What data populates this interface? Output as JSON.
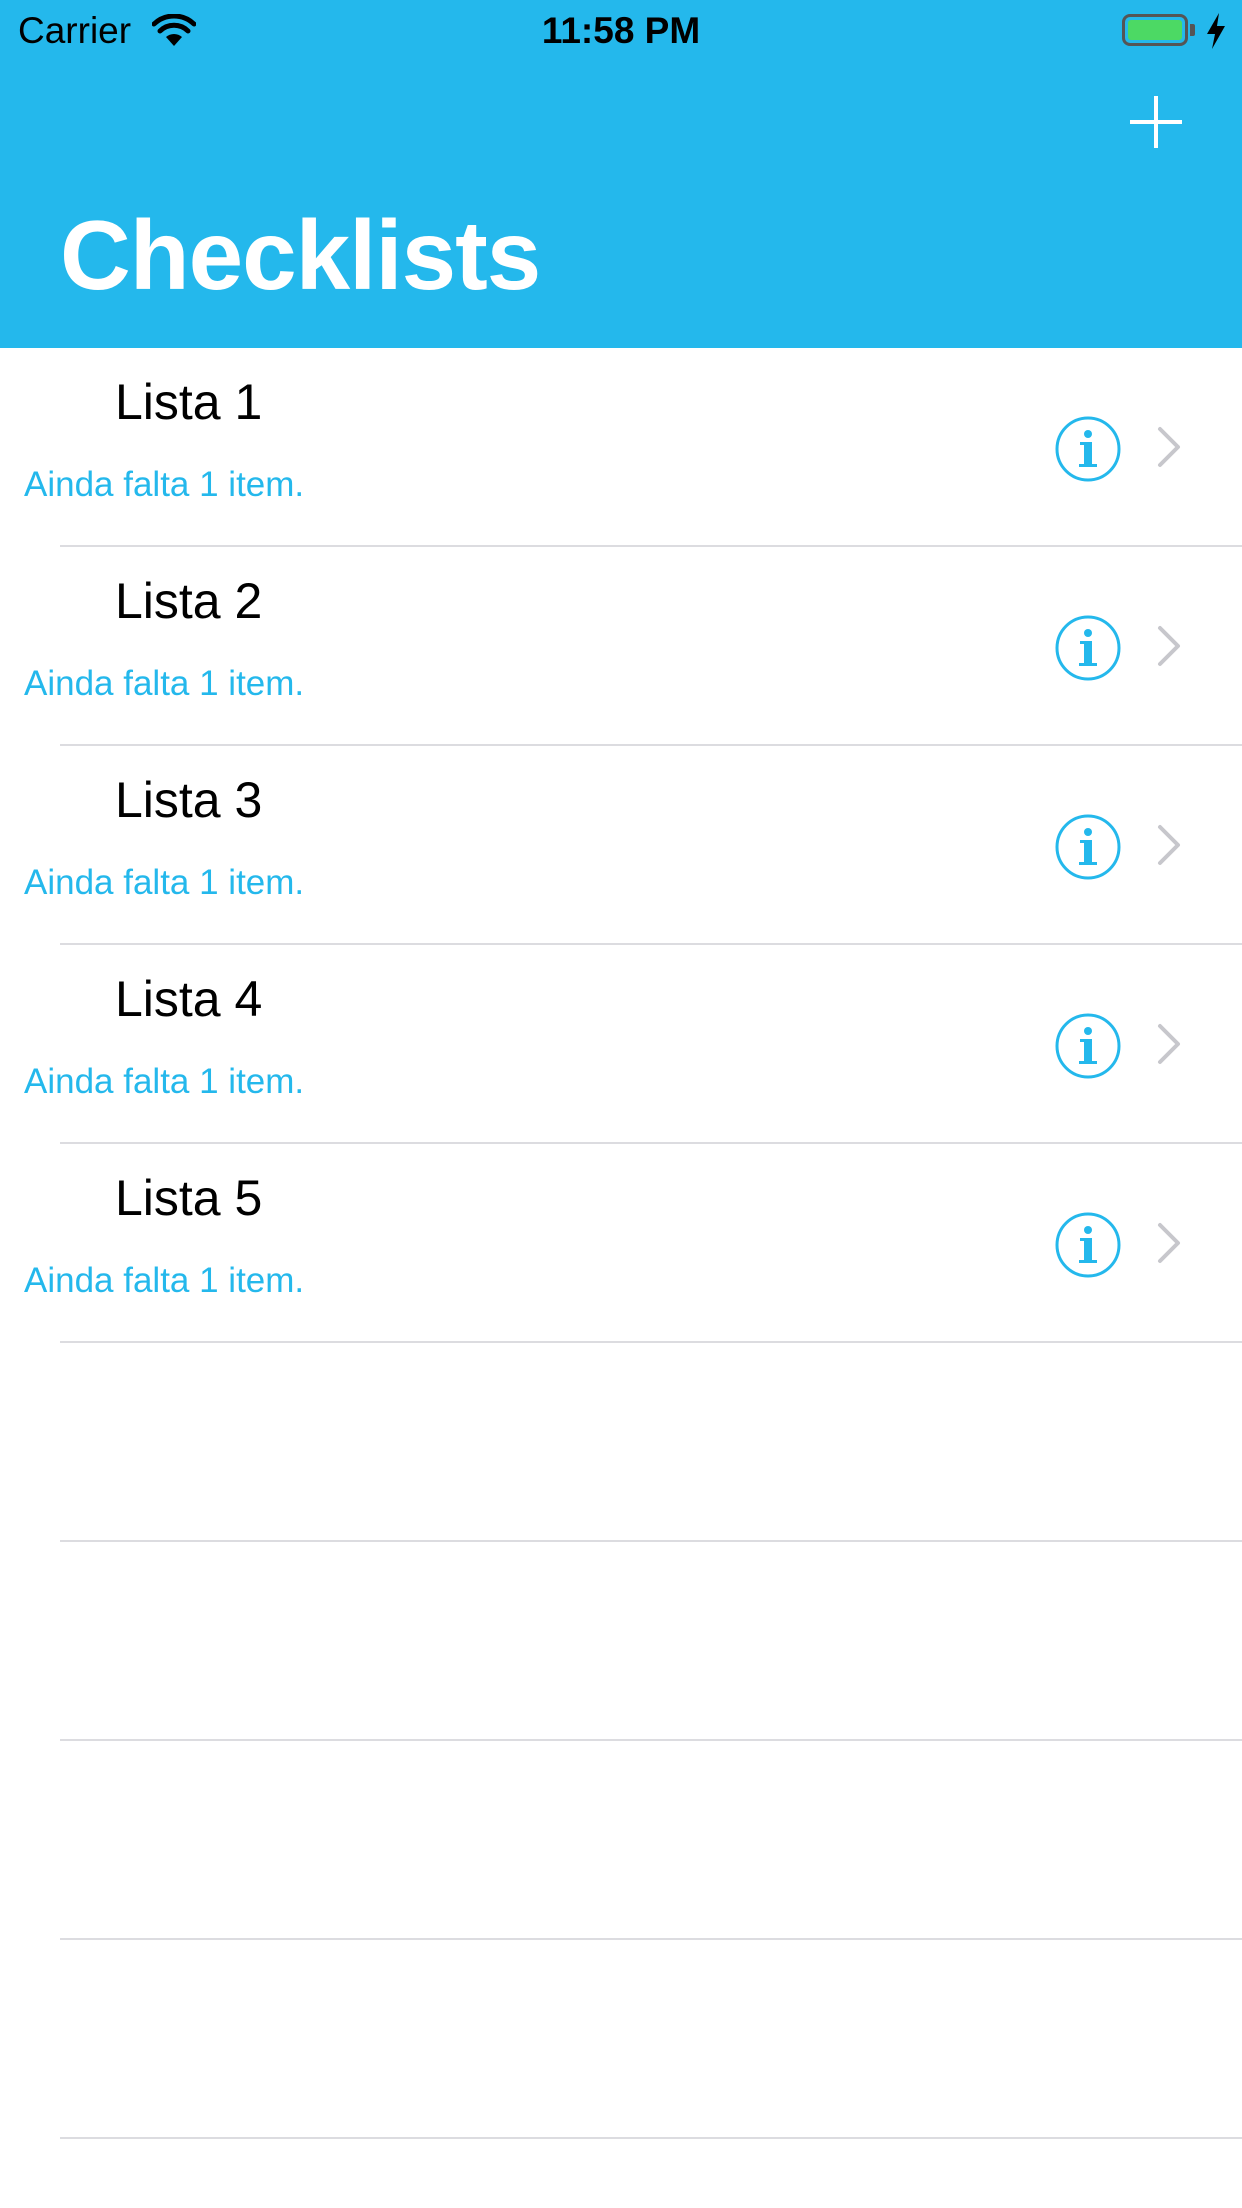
{
  "status_bar": {
    "carrier": "Carrier",
    "time": "11:58 PM"
  },
  "nav": {
    "title": "Checklists",
    "add_icon": "plus-icon"
  },
  "checklists": [
    {
      "name": "Lista 1",
      "subtitle": "Ainda falta 1 item."
    },
    {
      "name": "Lista 2",
      "subtitle": "Ainda falta 1 item."
    },
    {
      "name": "Lista 3",
      "subtitle": "Ainda falta 1 item."
    },
    {
      "name": "Lista 4",
      "subtitle": "Ainda falta 1 item."
    },
    {
      "name": "Lista 5",
      "subtitle": "Ainda falta 1 item."
    }
  ],
  "colors": {
    "accent": "#24b8ec",
    "battery": "#4cd964",
    "separator": "#dcdce0",
    "chevron": "#c7c7cc"
  }
}
